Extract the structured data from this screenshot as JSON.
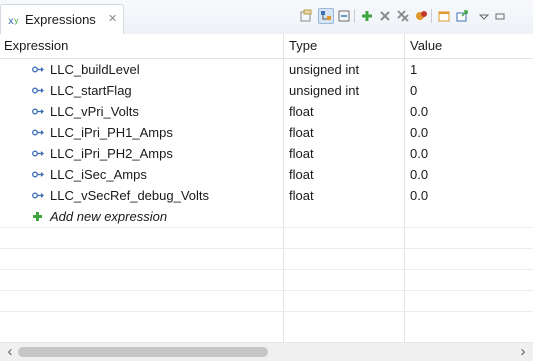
{
  "view": {
    "title": "Expressions",
    "close_glyph": "✕"
  },
  "toolbar": {
    "icons": [
      "show-type-names-icon",
      "show-logical-structure-icon",
      "collapse-all-icon",
      "add-expression-icon",
      "remove-expression-icon",
      "remove-all-expressions-icon",
      "refresh-icon",
      "new-window-icon",
      "export-icon",
      "view-menu-icon",
      "minimize-icon"
    ]
  },
  "table": {
    "columns": [
      "Expression",
      "Type",
      "Value"
    ],
    "rows": [
      {
        "expression": "LLC_buildLevel",
        "type": "unsigned int",
        "value": "1"
      },
      {
        "expression": "LLC_startFlag",
        "type": "unsigned int",
        "value": "0"
      },
      {
        "expression": "LLC_vPri_Volts",
        "type": "float",
        "value": "0.0"
      },
      {
        "expression": "LLC_iPri_PH1_Amps",
        "type": "float",
        "value": "0.0"
      },
      {
        "expression": "LLC_iPri_PH2_Amps",
        "type": "float",
        "value": "0.0"
      },
      {
        "expression": "LLC_iSec_Amps",
        "type": "float",
        "value": "0.0"
      },
      {
        "expression": "LLC_vSecRef_debug_Volts",
        "type": "float",
        "value": "0.0"
      }
    ],
    "add_new_label": "Add new expression"
  },
  "scrollbar": {
    "left_arrow": "‹",
    "right_arrow": "›"
  },
  "colors": {
    "icon_green": "#3fa63f",
    "icon_blue": "#3d6fb6",
    "icon_red": "#c0392b",
    "icon_orange": "#e0982a"
  }
}
